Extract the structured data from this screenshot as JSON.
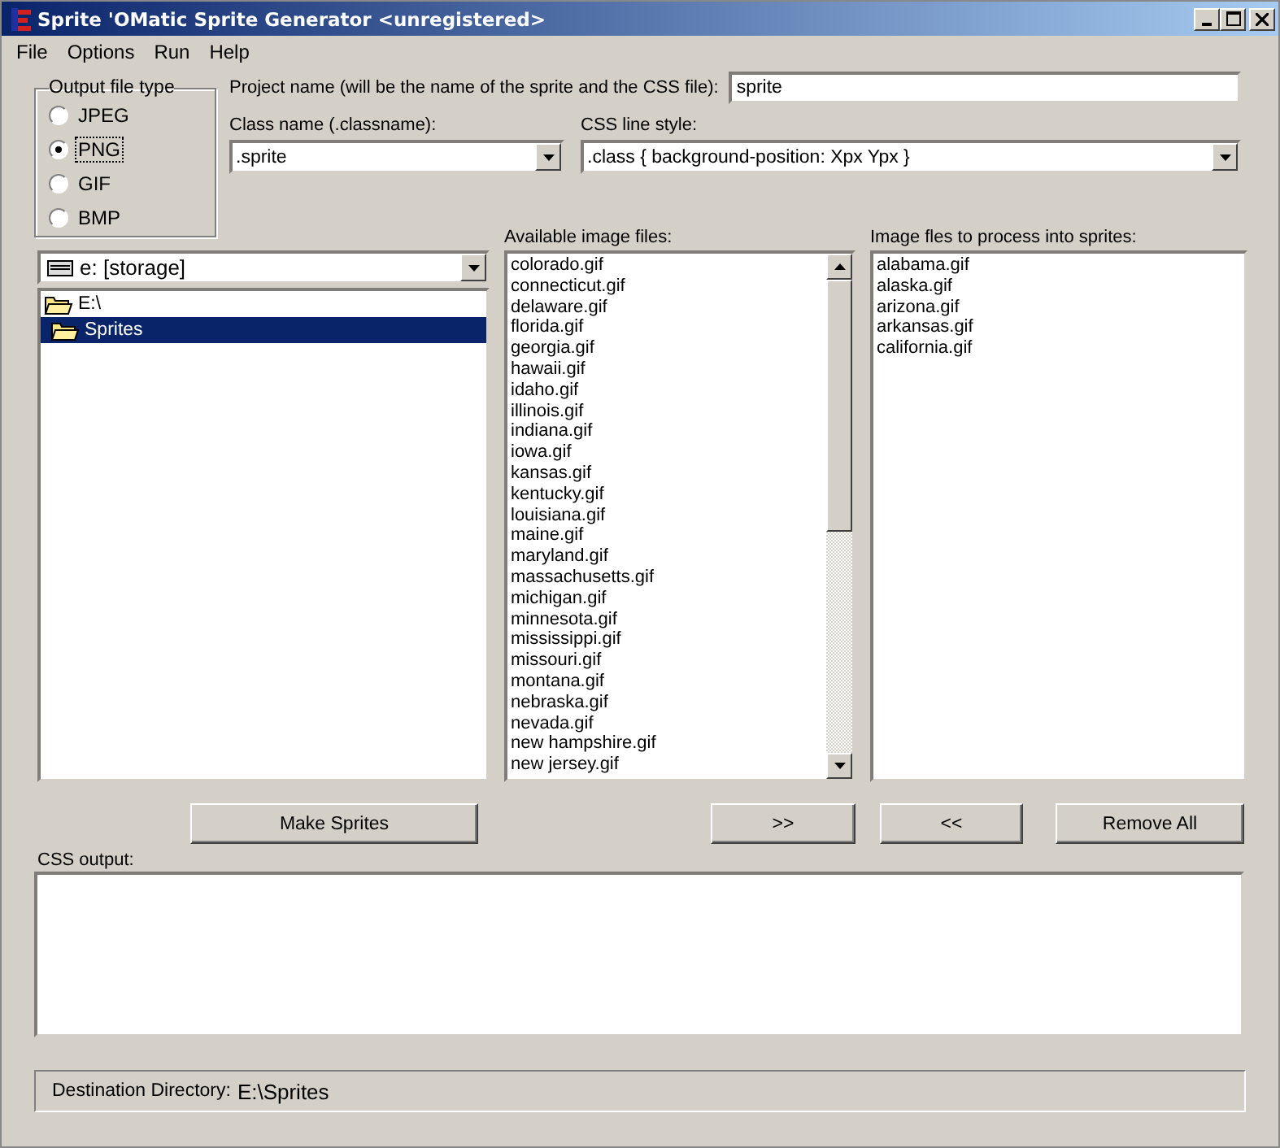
{
  "window": {
    "title": "Sprite 'OMatic Sprite Generator <unregistered>"
  },
  "menu": [
    "File",
    "Options",
    "Run",
    "Help"
  ],
  "output_file_type": {
    "label": "Output file type",
    "options": [
      {
        "label": "JPEG",
        "selected": false
      },
      {
        "label": "PNG",
        "selected": true
      },
      {
        "label": "GIF",
        "selected": false
      },
      {
        "label": "BMP",
        "selected": false
      }
    ]
  },
  "project_name": {
    "label": "Project name (will be the name of the sprite and the CSS file):",
    "value": "sprite"
  },
  "class_name": {
    "label": "Class name (.classname):",
    "value": ".sprite"
  },
  "css_line_style": {
    "label": "CSS line style:",
    "value": ".class { background-position: Xpx Ypx }"
  },
  "drive": {
    "value": "e: [storage]"
  },
  "folders": [
    {
      "label": "E:\\",
      "selected": false,
      "children": [
        {
          "label": "Sprites",
          "selected": true
        }
      ]
    }
  ],
  "available_files": {
    "label": "Available image files:",
    "items": [
      "colorado.gif",
      "connecticut.gif",
      "delaware.gif",
      "florida.gif",
      "georgia.gif",
      "hawaii.gif",
      "idaho.gif",
      "illinois.gif",
      "indiana.gif",
      "iowa.gif",
      "kansas.gif",
      "kentucky.gif",
      "louisiana.gif",
      "maine.gif",
      "maryland.gif",
      "massachusetts.gif",
      "michigan.gif",
      "minnesota.gif",
      "mississippi.gif",
      "missouri.gif",
      "montana.gif",
      "nebraska.gif",
      "nevada.gif",
      "new hampshire.gif",
      "new jersey.gif"
    ]
  },
  "process_files": {
    "label": "Image fles to process into sprites:",
    "items": [
      "alabama.gif",
      "alaska.gif",
      "arizona.gif",
      "arkansas.gif",
      "california.gif"
    ]
  },
  "buttons": {
    "make": "Make Sprites",
    "add": ">>",
    "remove": "<<",
    "remove_all": "Remove All"
  },
  "css_output": {
    "label": "CSS output:"
  },
  "status": {
    "label": "Destination Directory:",
    "value": "E:\\Sprites"
  }
}
